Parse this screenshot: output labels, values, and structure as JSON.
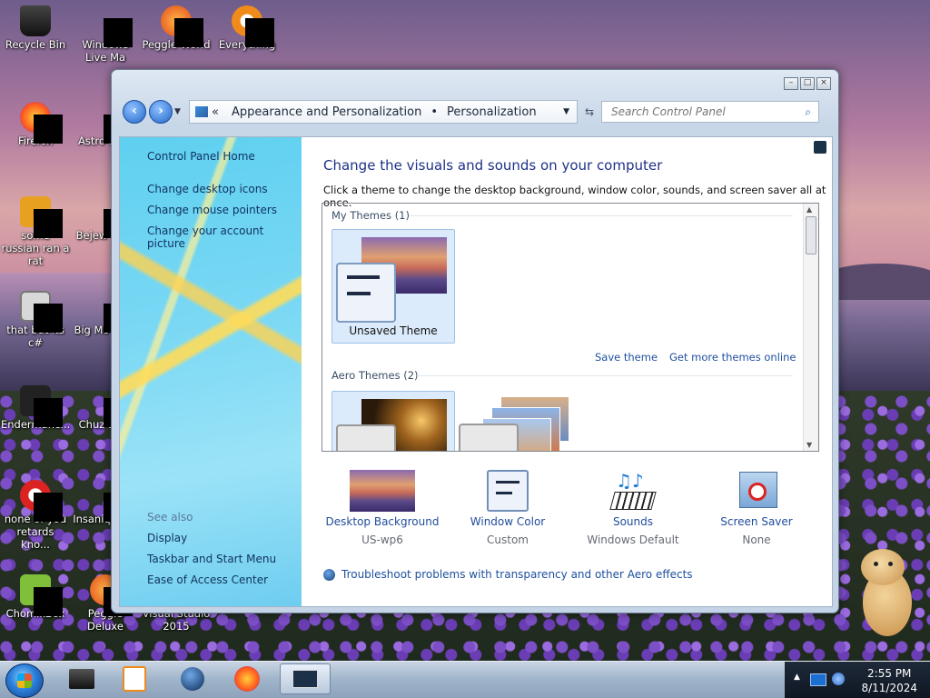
{
  "desktop": {
    "icons": [
      {
        "label": "Recycle Bin"
      },
      {
        "label": "Windows Live Ma"
      },
      {
        "label": "Peggle World"
      },
      {
        "label": "Everything"
      },
      {
        "label": "Firefox"
      },
      {
        "label": "Astro Delu"
      },
      {
        "label": "some russian ran a rat"
      },
      {
        "label": "Bejew Delu"
      },
      {
        "label": "that but its c#"
      },
      {
        "label": "Big Mo Delu"
      },
      {
        "label": "Endermanc..."
      },
      {
        "label": "Chuz Delu"
      },
      {
        "label": "none of you retards kno..."
      },
      {
        "label": "Insaniq Delu"
      },
      {
        "label": "ChomikBox"
      },
      {
        "label": "Peggle Deluxe"
      },
      {
        "label": "Visual Studio 2015"
      }
    ]
  },
  "window": {
    "breadcrumb": {
      "root_chevron": "«",
      "item1": "Appearance and Personalization",
      "separator": "•",
      "item2": "Personalization"
    },
    "search": {
      "placeholder": "Search Control Panel"
    },
    "nav": {
      "home": "Control Panel Home",
      "links": [
        "Change desktop icons",
        "Change mouse pointers",
        "Change your account picture"
      ],
      "see_also_header": "See also",
      "see_also": [
        "Display",
        "Taskbar and Start Menu",
        "Ease of Access Center"
      ]
    },
    "main": {
      "title": "Change the visuals and sounds on your computer",
      "subtitle": "Click a theme to change the desktop background, window color, sounds, and screen saver all at once.",
      "my_themes_header": "My Themes (1)",
      "unsaved_theme": "Unsaved Theme",
      "save_theme": "Save theme",
      "get_more": "Get more themes online",
      "aero_themes_header": "Aero Themes (2)"
    },
    "bottom": [
      {
        "label": "Desktop Background",
        "value": "US-wp6",
        "icon": "desktop-background-icon"
      },
      {
        "label": "Window Color",
        "value": "Custom",
        "icon": "window-color-icon"
      },
      {
        "label": "Sounds",
        "value": "Windows Default",
        "icon": "sounds-icon"
      },
      {
        "label": "Screen Saver",
        "value": "None",
        "icon": "screen-saver-icon"
      }
    ],
    "troubleshoot": "Troubleshoot problems with transparency and other Aero effects"
  },
  "taskbar": {
    "time": "2:55 PM",
    "date": "8/11/2024"
  }
}
